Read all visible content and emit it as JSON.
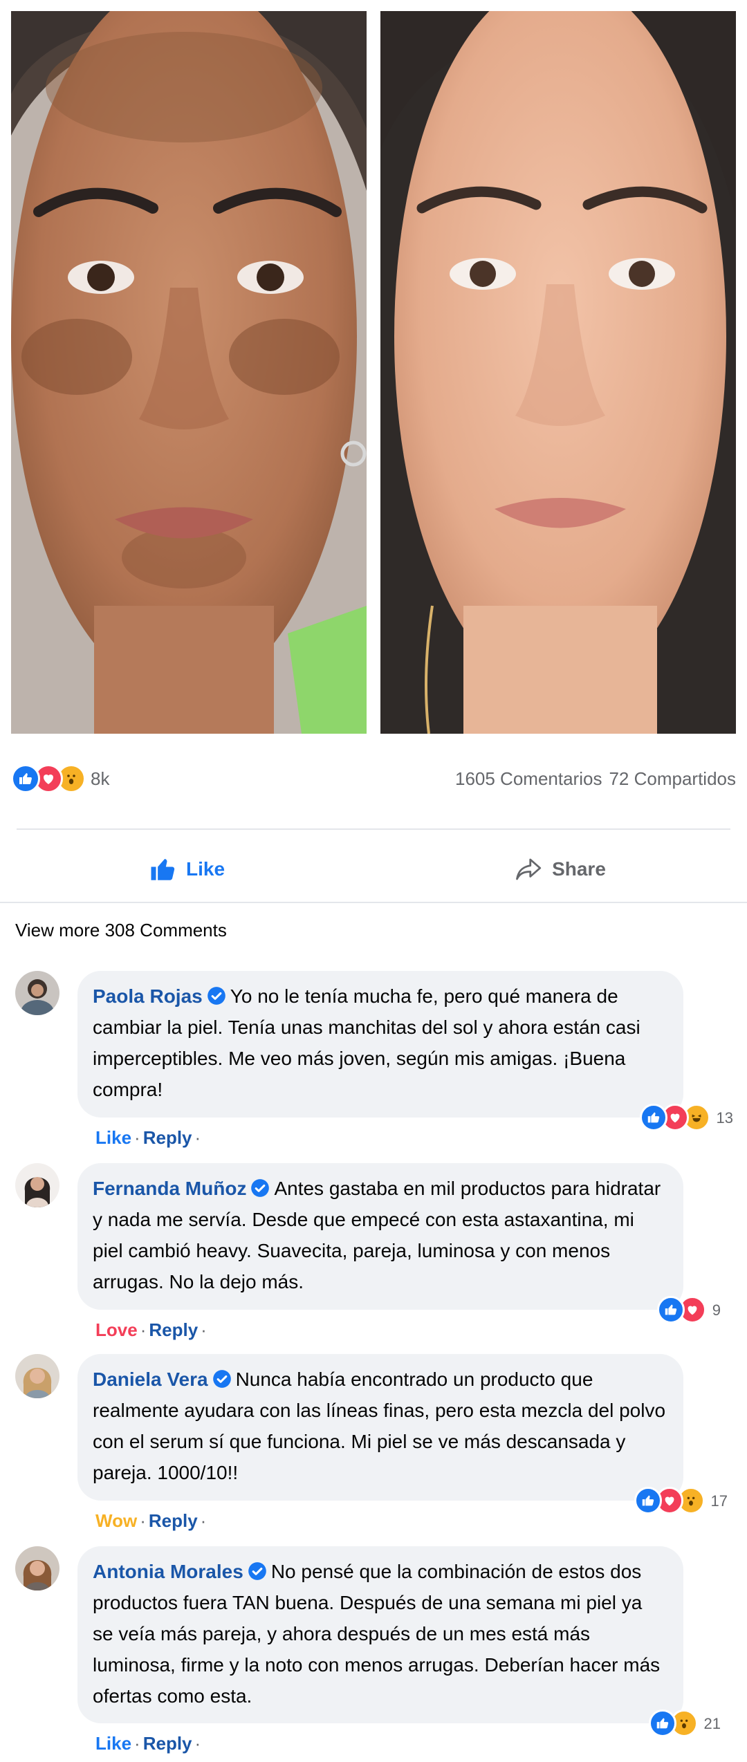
{
  "post": {
    "reaction_count": "8k",
    "comments_text": "1605 Comentarios",
    "shares_text": "72 Compartidos",
    "reaction_icons": [
      "like-icon",
      "love-icon",
      "wow-icon"
    ]
  },
  "actions": {
    "like_label": "Like",
    "share_label": "Share"
  },
  "view_more": "View more 308 Comments",
  "comments": [
    {
      "author": "Paola Rojas",
      "text": "Yo no le tenía mucha fe, pero qué manera de cambiar la piel. Tenía unas manchitas del sol y ahora están casi imperceptibles. Me veo más joven, según mis amigas. ¡Buena compra!",
      "reaction_icons": [
        "like-icon",
        "love-icon",
        "haha-icon"
      ],
      "reaction_count": "13",
      "action_label": "Like",
      "reply_label": "Reply"
    },
    {
      "author": "Fernanda Muñoz",
      "text": "Antes gastaba en mil productos para hidratar y nada me servía. Desde que empecé con esta astaxantina, mi piel cambió heavy. Suavecita, pareja, luminosa y con menos arrugas. No la dejo más.",
      "reaction_icons": [
        "like-icon",
        "love-icon"
      ],
      "reaction_count": "9",
      "action_label": "Love",
      "reply_label": "Reply"
    },
    {
      "author": "Daniela Vera",
      "text": "Nunca había encontrado un producto que realmente ayudara con las líneas finas, pero esta mezcla del polvo con el serum sí que funciona. Mi piel se ve más descansada y pareja. 1000/10!!",
      "reaction_icons": [
        "like-icon",
        "love-icon",
        "wow-icon"
      ],
      "reaction_count": "17",
      "action_label": "Wow",
      "reply_label": "Reply"
    },
    {
      "author": "Antonia Morales",
      "text": "No pensé que la combinación de estos dos productos fuera TAN buena. Después de una semana mi piel ya se veía más pareja, y ahora después de un mes está más luminosa, firme y la noto con menos arrugas. Deberían hacer más ofertas como esta.",
      "reaction_icons": [
        "like-icon",
        "wow-icon"
      ],
      "reaction_count": "21",
      "action_label": "Like",
      "reply_label": "Reply"
    }
  ],
  "colors": {
    "facebook_blue": "#1877f2",
    "author_blue": "#1a56a8",
    "love_red": "#f33e58",
    "wow_yellow": "#f7b125",
    "bubble_gray": "#f0f2f5",
    "muted_text": "#65676b"
  }
}
